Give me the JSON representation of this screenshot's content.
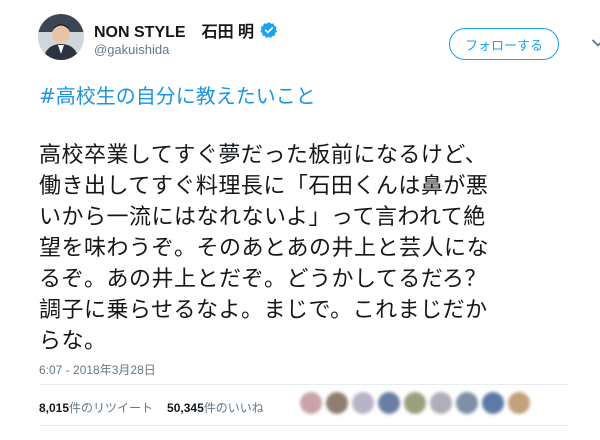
{
  "user": {
    "display_name": "NON STYLE　石田 明",
    "handle": "@gakuishida",
    "verified": true
  },
  "follow_button": {
    "label": "フォローする"
  },
  "tweet": {
    "hashtag": "#高校生の自分に教えたいこと",
    "lines": [
      "高校卒業してすぐ夢だった板前になるけど、",
      "働き出してすぐ料理長に「石田くんは鼻が悪",
      "いから一流にはなれないよ」って言われて絶",
      "望を味わうぞ。そのあとあの井上と芸人にな",
      "るぞ。あの井上とだぞ。どうかしてるだろ？",
      "調子に乗らせるなよ。まじで。これまじだか",
      "らな。"
    ],
    "timestamp": "6:07 - 2018年3月28日"
  },
  "stats": {
    "retweets_count": "8,015",
    "retweets_label": "件のリツイート",
    "likes_count": "50,345",
    "likes_label": "件のいいね"
  },
  "likers": {
    "colors": [
      "#c9a3a8",
      "#8f7d70",
      "#b8b4c8",
      "#6a7fa3",
      "#9ba07c",
      "#b0aeb8",
      "#7e8fa6",
      "#5c7aa8",
      "#c2a17c"
    ]
  },
  "colors": {
    "accent": "#1da1f2",
    "hashtag": "#1b95e0",
    "text": "#14171a",
    "muted": "#657786"
  },
  "icons": {
    "verified": "verified-badge-icon",
    "menu": "chevron-down-icon"
  }
}
